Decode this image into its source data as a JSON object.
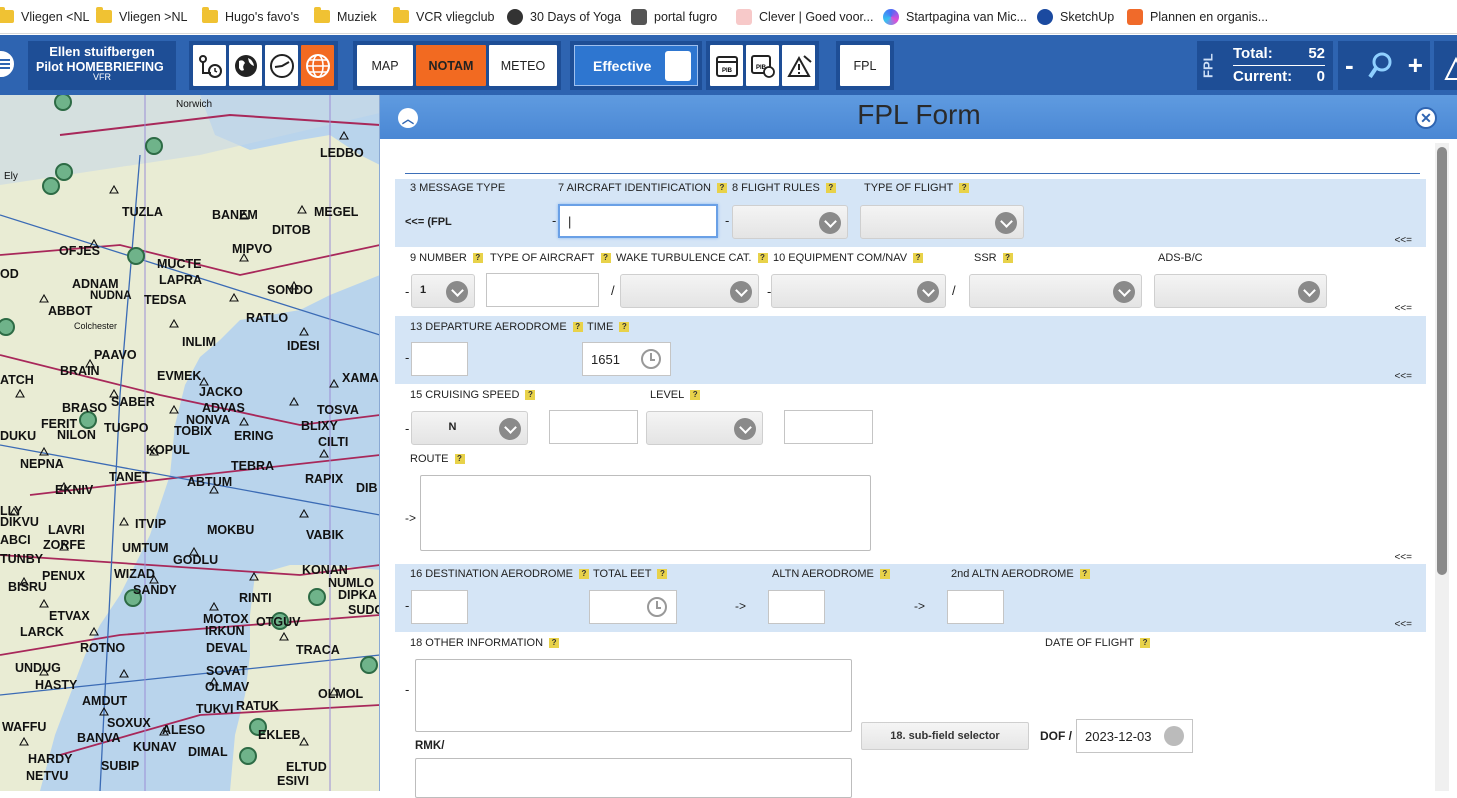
{
  "bookmarks": [
    {
      "label": "Vliegen <NL",
      "icon": "folder-icon"
    },
    {
      "label": "Vliegen >NL",
      "icon": "folder-icon"
    },
    {
      "label": "Hugo's favo's",
      "icon": "folder-icon"
    },
    {
      "label": "Muziek",
      "icon": "folder-icon"
    },
    {
      "label": "VCR vliegclub",
      "icon": "folder-icon"
    },
    {
      "label": "30 Days of Yoga",
      "icon": "yoga-icon"
    },
    {
      "label": "portal fugro",
      "icon": "portal-icon"
    },
    {
      "label": "Clever | Goed voor...",
      "icon": "clever-icon"
    },
    {
      "label": "Startpagina van Mic...",
      "icon": "startpage-icon"
    },
    {
      "label": "SketchUp",
      "icon": "sketchup-icon"
    },
    {
      "label": "Plannen en organis...",
      "icon": "planner-icon"
    }
  ],
  "user": {
    "name": "Ellen stuifbergen",
    "role": "Pilot HOMEBRIEFING",
    "mode": "VFR"
  },
  "views": {
    "map": "MAP",
    "notam": "NOTAM",
    "meteo": "METEO"
  },
  "effective_label": "Effective",
  "fpl_button": "FPL",
  "counter": {
    "vertical_label": "FPL",
    "total_label": "Total:",
    "total_value": "52",
    "current_label": "Current:",
    "current_value": "0"
  },
  "zoom": {
    "out": "-",
    "in": "+"
  },
  "panel": {
    "title": "FPL Form"
  },
  "form": {
    "message_type_label": "3 MESSAGE TYPE",
    "message_type_value": "<<= (FPL",
    "aircraft_id_label": "7 AIRCRAFT IDENTIFICATION",
    "aircraft_id_value": "|",
    "flight_rules_label": "8 FLIGHT RULES",
    "type_of_flight_label": "TYPE OF FLIGHT",
    "number_label": "9 NUMBER",
    "number_value": "1",
    "type_aircraft_label": "TYPE OF AIRCRAFT",
    "wake_label": "WAKE TURBULENCE CAT.",
    "equipment_label": "10 EQUIPMENT COM/NAV",
    "ssr_label": "SSR",
    "adsbc_label": "ADS-B/C",
    "departure_label": "13 DEPARTURE AERODROME",
    "time_label": "TIME",
    "time_value": "1651",
    "cruise_label": "15 CRUISING SPEED",
    "cruise_unit": "N",
    "level_label": "LEVEL",
    "route_label": "ROUTE",
    "route_arrow": "->",
    "destination_label": "16 DESTINATION AERODROME",
    "total_eet_label": "TOTAL EET",
    "altn_label": "ALTN AERODROME",
    "altn2_label": "2nd ALTN AERODROME",
    "other_info_label": "18 OTHER INFORMATION",
    "date_of_flight_label": "DATE OF FLIGHT",
    "rmk_label": "RMK/",
    "subfield_selector": "18. sub-field selector",
    "dof_label": "DOF /",
    "dof_value": "2023-12-03",
    "back_marker": "<<=",
    "dash": "-",
    "slash": "/",
    "arrow": "->",
    "help_mark": "?"
  },
  "map_labels": [
    "Norwich",
    "LEDBO",
    "Ely",
    "TUZLA",
    "BANEM",
    "MEGEL",
    "DITOB",
    "OFJES",
    "MIPVO",
    "MUCTE",
    "LAPRA",
    "ADNAM",
    "NUDNA",
    "TEDSA",
    "SONDO",
    "ABBOT",
    "RATLO",
    "Colchester",
    "INLIM",
    "IDESI",
    "PAAVO",
    "BRAIN",
    "EVMEK",
    "JACKO",
    "XAMA",
    "SABER",
    "ADVAS",
    "TOSVA",
    "BRASO",
    "NONVA",
    "BLIXY",
    "FERIT",
    "TUGPO",
    "TOBIX",
    "ERING",
    "CILTI",
    "NILON",
    "DUKU",
    "KOPUL",
    "NEPNA",
    "TEBRA",
    "TANET",
    "RAPIX",
    "DIB",
    "EKNIV",
    "ABTUM",
    "LLY",
    "DIKVU",
    "LAVRI",
    "ITVIP",
    "MOKBU",
    "ABCI",
    "ZORFE",
    "VABIK",
    "UMTUM",
    "TUNBY",
    "GODLU",
    "KONAN",
    "PENUX",
    "WIZAD",
    "NUMLO",
    "SANDY",
    "DIPKA",
    "BISRU",
    "RINTI",
    "SUDO",
    "ETVAX",
    "OTGUV",
    "MOTOX",
    "IRKUN",
    "LARCK",
    "ROTNO",
    "DEVAL",
    "TRACA",
    "UNDUG",
    "SOVAT",
    "HASTY",
    "OLMAV",
    "OLMOL",
    "AMDUT",
    "TUKVI",
    "RATUK",
    "WAFFU",
    "SOXUX",
    "ALESO",
    "BANVA",
    "EKLEB",
    "KUNAV",
    "DIMAL",
    "HARDY",
    "SUBIP",
    "ELTUD",
    "NETVU",
    "ESIVI",
    "ATCH",
    "OD"
  ],
  "colors": {
    "brand": "#2e64b1",
    "accent": "#f26a21",
    "shade": "#d5e5f6"
  }
}
